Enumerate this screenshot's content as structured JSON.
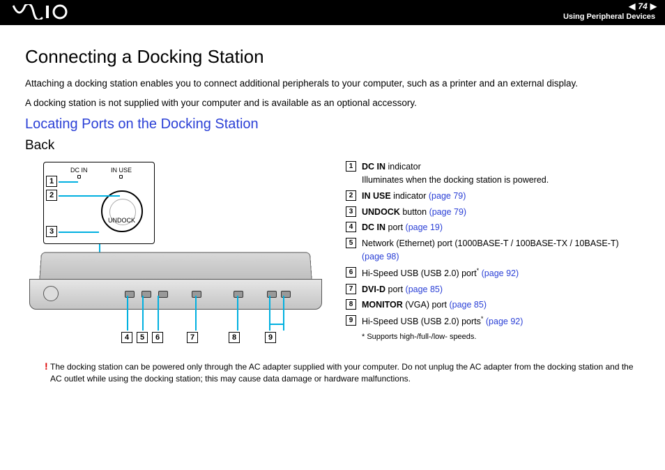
{
  "header": {
    "page_number": "74",
    "section": "Using Peripheral Devices"
  },
  "title": "Connecting a Docking Station",
  "intro": {
    "p1": "Attaching a docking station enables you to connect additional peripherals to your computer, such as a printer and an external display.",
    "p2": "A docking station is not supplied with your computer and is available as an optional accessory."
  },
  "subheading": "Locating Ports on the Docking Station",
  "view_label": "Back",
  "diagram": {
    "dc_in_label": "DC IN",
    "in_use_label": "IN USE",
    "undock_label": "UNDOCK",
    "callouts": [
      "1",
      "2",
      "3",
      "4",
      "5",
      "6",
      "7",
      "8",
      "9"
    ]
  },
  "legend": [
    {
      "num": "1",
      "bold": "DC IN",
      "text": " indicator",
      "sub": "Illuminates when the docking station is powered."
    },
    {
      "num": "2",
      "bold": "IN USE",
      "text": " indicator ",
      "link": "(page 79)"
    },
    {
      "num": "3",
      "bold": "UNDOCK",
      "text": " button ",
      "link": "(page 79)"
    },
    {
      "num": "4",
      "bold": "DC IN",
      "text": " port ",
      "link": "(page 19)"
    },
    {
      "num": "5",
      "text": "Network (Ethernet) port (1000BASE-T / 100BASE-TX / 10BASE-T) ",
      "link": "(page 98)"
    },
    {
      "num": "6",
      "text": "Hi-Speed USB (USB 2.0) port",
      "sup": "*",
      "link": " (page 92)"
    },
    {
      "num": "7",
      "bold": "DVI-D",
      "text": " port ",
      "link": "(page 85)"
    },
    {
      "num": "8",
      "bold": "MONITOR",
      "text": " (VGA) port ",
      "link": "(page 85)"
    },
    {
      "num": "9",
      "text": "Hi-Speed USB (USB 2.0) ports",
      "sup": "*",
      "link": " (page 92)"
    }
  ],
  "footnote": {
    "mark": "*",
    "text": "Supports high-/full-/low- speeds."
  },
  "warning": {
    "mark": "!",
    "text": "The docking station can be powered only through the AC adapter supplied with your computer. Do not unplug the AC adapter from the docking station and the AC outlet while using the docking station; this may cause data damage or hardware malfunctions."
  }
}
